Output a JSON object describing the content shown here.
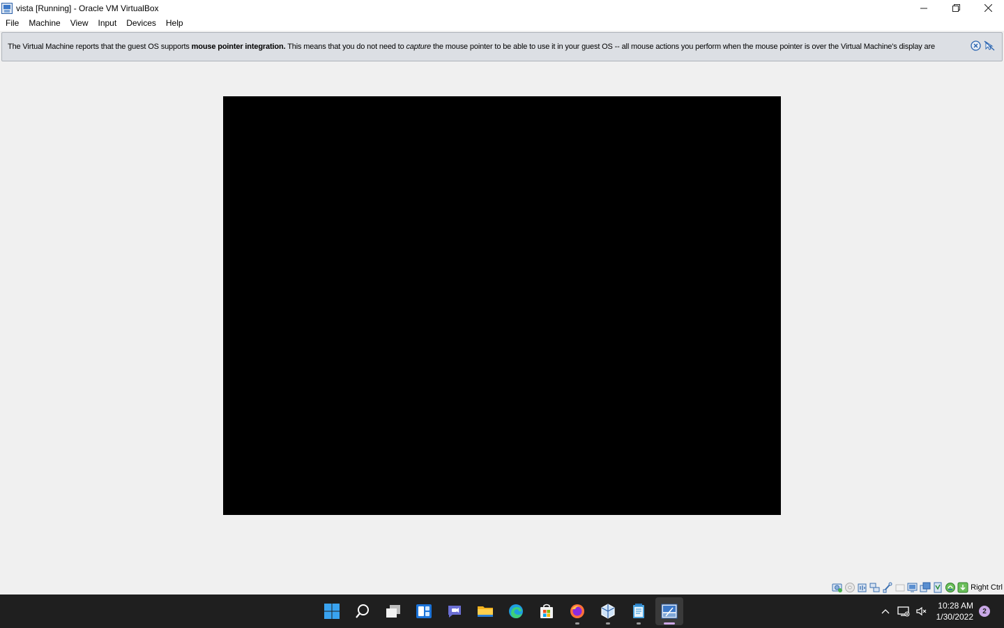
{
  "window": {
    "title": "vista [Running] - Oracle VM VirtualBox",
    "app_icon": "virtualbox-vm-icon"
  },
  "menu": {
    "items": [
      {
        "label": "File"
      },
      {
        "label": "Machine"
      },
      {
        "label": "View"
      },
      {
        "label": "Input"
      },
      {
        "label": "Devices"
      },
      {
        "label": "Help"
      }
    ]
  },
  "notice": {
    "part1": "The Virtual Machine reports that the guest OS supports ",
    "bold": "mouse pointer integration.",
    "part2": " This means that you do not need to ",
    "italic": "capture",
    "part3": " the mouse pointer to be able to use it in your guest OS -- all mouse actions you perform when the mouse pointer is over the Virtual Machine's display are"
  },
  "statusbar": {
    "icons": [
      "hard-disk-icon",
      "optical-drive-icon",
      "audio-icon",
      "network-icon",
      "usb-icon",
      "shared-folders-icon",
      "display-icon",
      "video-capture-icon",
      "cpu-icon",
      "mouse-integration-icon",
      "keyboard-capture-icon"
    ],
    "host_key": "Right Ctrl"
  },
  "taskbar": {
    "apps": [
      "windows-start-icon",
      "search-icon",
      "task-view-icon",
      "widgets-icon",
      "teams-chat-icon",
      "file-explorer-icon",
      "edge-icon",
      "microsoft-store-icon",
      "firefox-icon",
      "virtualbox-icon",
      "notepad-icon",
      "vista-vm-window-icon"
    ]
  },
  "tray": {
    "time": "10:28 AM",
    "date": "1/30/2022",
    "notifications": "2"
  },
  "colors": {
    "taskbar_bg": "#1f1f1f",
    "notice_bg": "#dcdfe4",
    "vm_screen": "#000000",
    "accent": "#0078d4"
  }
}
